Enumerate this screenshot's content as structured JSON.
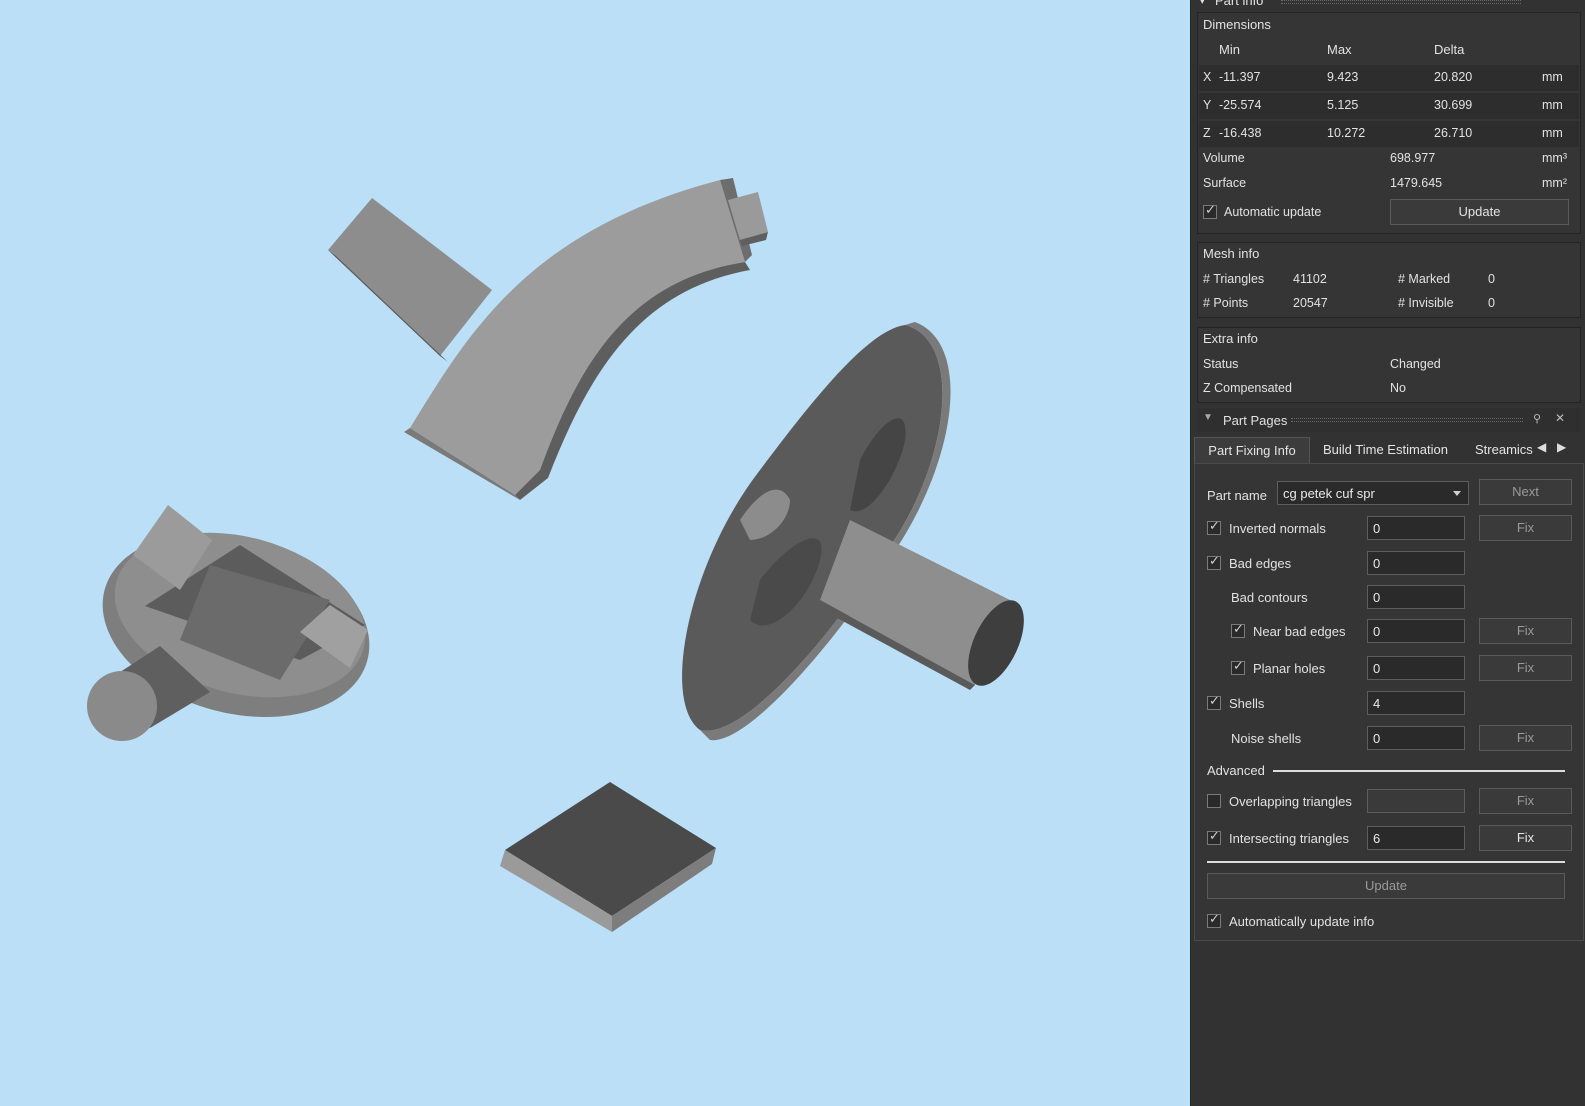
{
  "part_info": {
    "title": "Part info",
    "dimensions_label": "Dimensions",
    "headers": {
      "min": "Min",
      "max": "Max",
      "delta": "Delta"
    },
    "rows": [
      {
        "axis": "X",
        "min": "-11.397",
        "max": "9.423",
        "delta": "20.820",
        "unit": "mm"
      },
      {
        "axis": "Y",
        "min": "-25.574",
        "max": "5.125",
        "delta": "30.699",
        "unit": "mm"
      },
      {
        "axis": "Z",
        "min": "-16.438",
        "max": "10.272",
        "delta": "26.710",
        "unit": "mm"
      }
    ],
    "volume_label": "Volume",
    "volume_value": "698.977",
    "volume_unit": "mm³",
    "surface_label": "Surface",
    "surface_value": "1479.645",
    "surface_unit": "mm²",
    "auto_update_label": "Automatic update",
    "update_button": "Update",
    "mesh_info_label": "Mesh info",
    "triangles_label": "# Triangles",
    "triangles_value": "41102",
    "marked_label": "# Marked",
    "marked_value": "0",
    "points_label": "# Points",
    "points_value": "20547",
    "invisible_label": "# Invisible",
    "invisible_value": "0",
    "extra_info_label": "Extra info",
    "status_label": "Status",
    "status_value": "Changed",
    "zcomp_label": "Z Compensated",
    "zcomp_value": "No"
  },
  "part_pages": {
    "title": "Part Pages",
    "tabs": [
      "Part Fixing Info",
      "Build Time Estimation",
      "Streamics F"
    ],
    "part_name_label": "Part name",
    "part_name_value": "cg petek cuf spr",
    "next_button": "Next",
    "fix_label": "Fix",
    "inverted_normals_label": "Inverted normals",
    "inverted_normals_value": "0",
    "bad_edges_label": "Bad edges",
    "bad_edges_value": "0",
    "bad_contours_label": "Bad contours",
    "bad_contours_value": "0",
    "near_bad_edges_label": "Near bad edges",
    "near_bad_edges_value": "0",
    "planar_holes_label": "Planar holes",
    "planar_holes_value": "0",
    "shells_label": "Shells",
    "shells_value": "4",
    "noise_shells_label": "Noise shells",
    "noise_shells_value": "0",
    "advanced_label": "Advanced",
    "overlapping_label": "Overlapping triangles",
    "overlapping_value": "",
    "intersecting_label": "Intersecting triangles",
    "intersecting_value": "6",
    "update_button": "Update",
    "auto_update_info_label": "Automatically update info"
  },
  "colors": {
    "viewport_bg": "#bcdff8",
    "panel_bg": "#323232",
    "mesh_gray": "#8c8c8c"
  }
}
